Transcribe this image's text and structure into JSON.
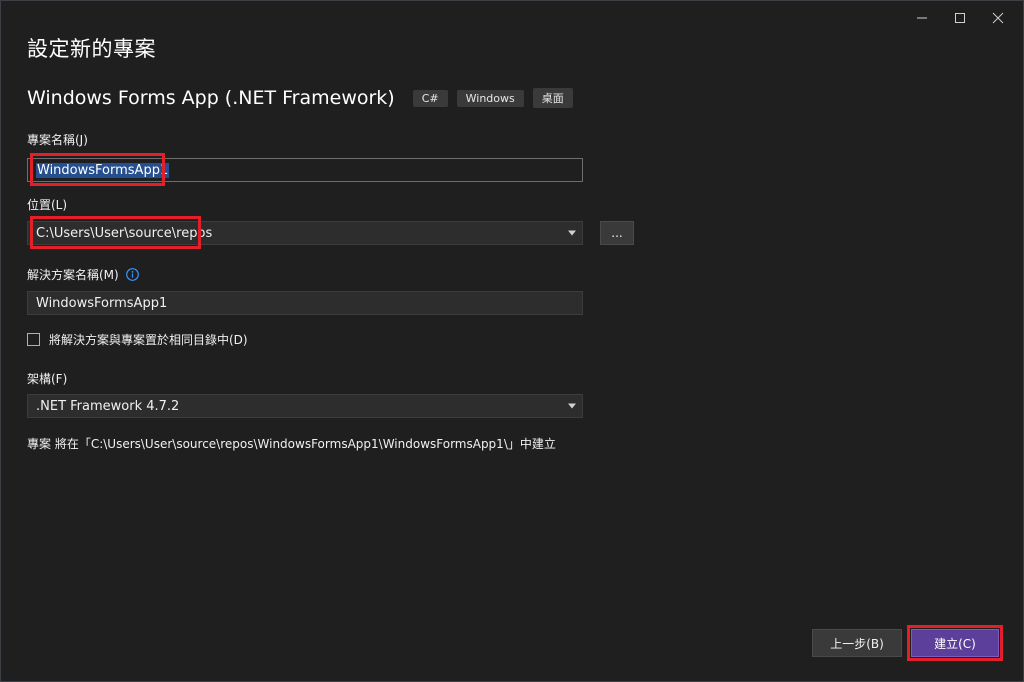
{
  "dialog": {
    "title": "設定新的專案"
  },
  "template": {
    "name": "Windows Forms App (.NET Framework)",
    "tags": [
      "C#",
      "Windows",
      "桌面"
    ]
  },
  "form": {
    "project_name_label": "專案名稱(J)",
    "project_name_value": "WindowsFormsApp1",
    "location_label": "位置(L)",
    "location_value": "C:\\Users\\User\\source\\repos",
    "browse_label": "...",
    "solution_name_label": "解決方案名稱(M)",
    "solution_name_value": "WindowsFormsApp1",
    "same_dir_checkbox_label": "將解決方案與專案置於相同目錄中(D)",
    "same_dir_checked": false,
    "framework_label": "架構(F)",
    "framework_value": ".NET Framework 4.7.2"
  },
  "summary": {
    "text": "專案 將在「C:\\Users\\User\\source\\repos\\WindowsFormsApp1\\WindowsFormsApp1\\」中建立"
  },
  "footer": {
    "back_label": "上一步(B)",
    "create_label": "建立(C)"
  },
  "icons": {
    "minimize": "minimize-icon",
    "maximize": "maximize-icon",
    "close": "close-icon",
    "info": "info-icon",
    "dropdown": "chevron-down-icon"
  },
  "colors": {
    "background": "#1f1f1f",
    "accent": "#5b3f9a",
    "highlight_box": "#e3202a",
    "selection": "#264f8f",
    "info_icon": "#3794ff"
  }
}
